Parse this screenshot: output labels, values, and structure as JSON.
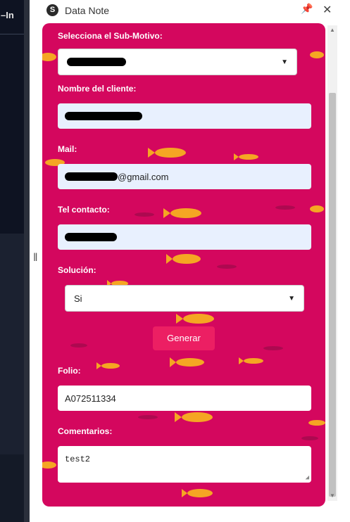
{
  "left_app": {
    "text": "–In"
  },
  "window": {
    "title": "Data Note",
    "logo_letter": "S",
    "pin_icon": "📌",
    "close_icon": "✕"
  },
  "form": {
    "submotivo_label": "Selecciona el Sub-Motivo:",
    "cliente_label": "Nombre del cliente:",
    "mail_label": "Mail:",
    "mail_visible_suffix": "@gmail.com",
    "tel_label": "Tel contacto:",
    "solucion_label": "Solución:",
    "solucion_value": "Si",
    "generar_label": "Generar",
    "folio_label": "Folio:",
    "folio_value": "A072511334",
    "comentarios_label": "Comentarios:",
    "comentarios_value": "test2"
  },
  "colors": {
    "accent": "#d4075e",
    "button": "#ec1f63",
    "fish": "#f5a623"
  }
}
